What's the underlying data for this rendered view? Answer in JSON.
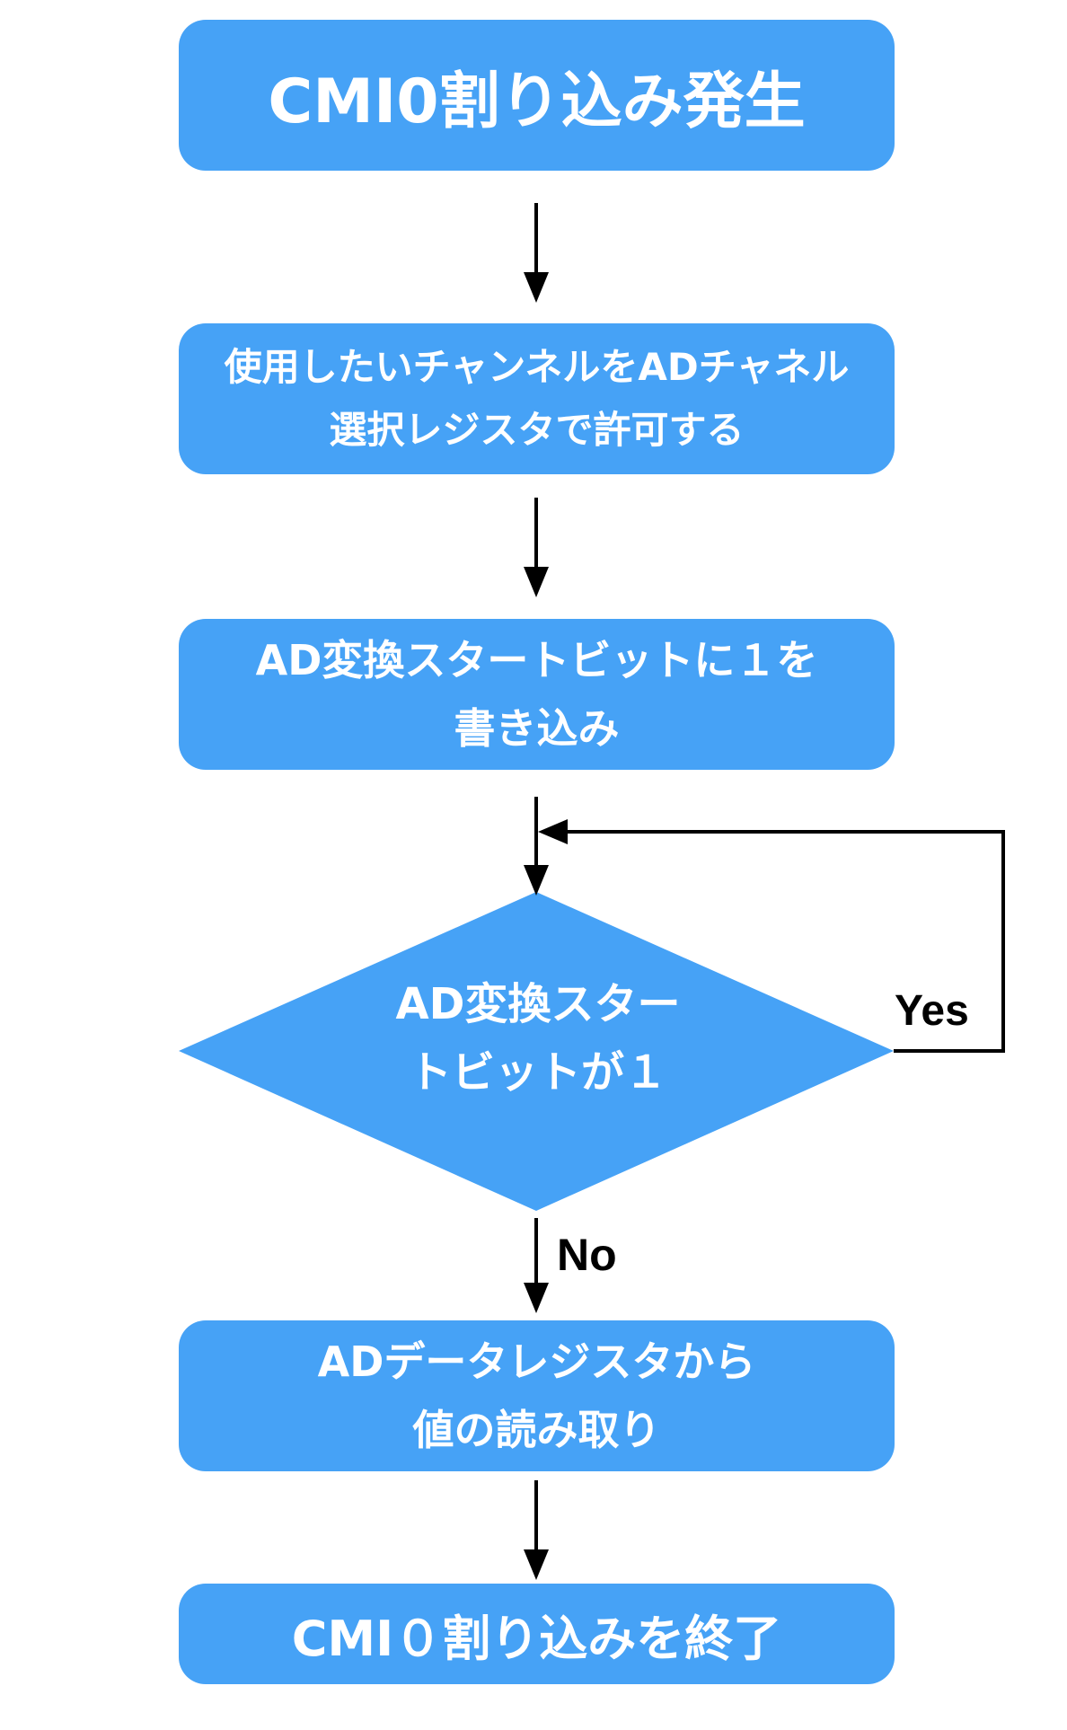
{
  "nodes": {
    "start": {
      "text": "CMI0割り込み発生"
    },
    "enable_channel": {
      "line1": "使用したいチャンネルをADチャネル",
      "line2": "選択レジスタで許可する"
    },
    "write_start_bit": {
      "line1": "AD変換スタートビットに１を",
      "line2": "書き込み"
    },
    "decision": {
      "line1": "AD変換スター",
      "line2": "トビットが１"
    },
    "read_data": {
      "line1": "ADデータレジスタから",
      "line2": "値の読み取り"
    },
    "end": {
      "text": "CMI０割り込みを終了"
    }
  },
  "edges": {
    "yes_label": "Yes",
    "no_label": "No"
  },
  "colors": {
    "node_fill": "#46a2f6",
    "node_text": "#ffffff",
    "connector": "#000000"
  }
}
